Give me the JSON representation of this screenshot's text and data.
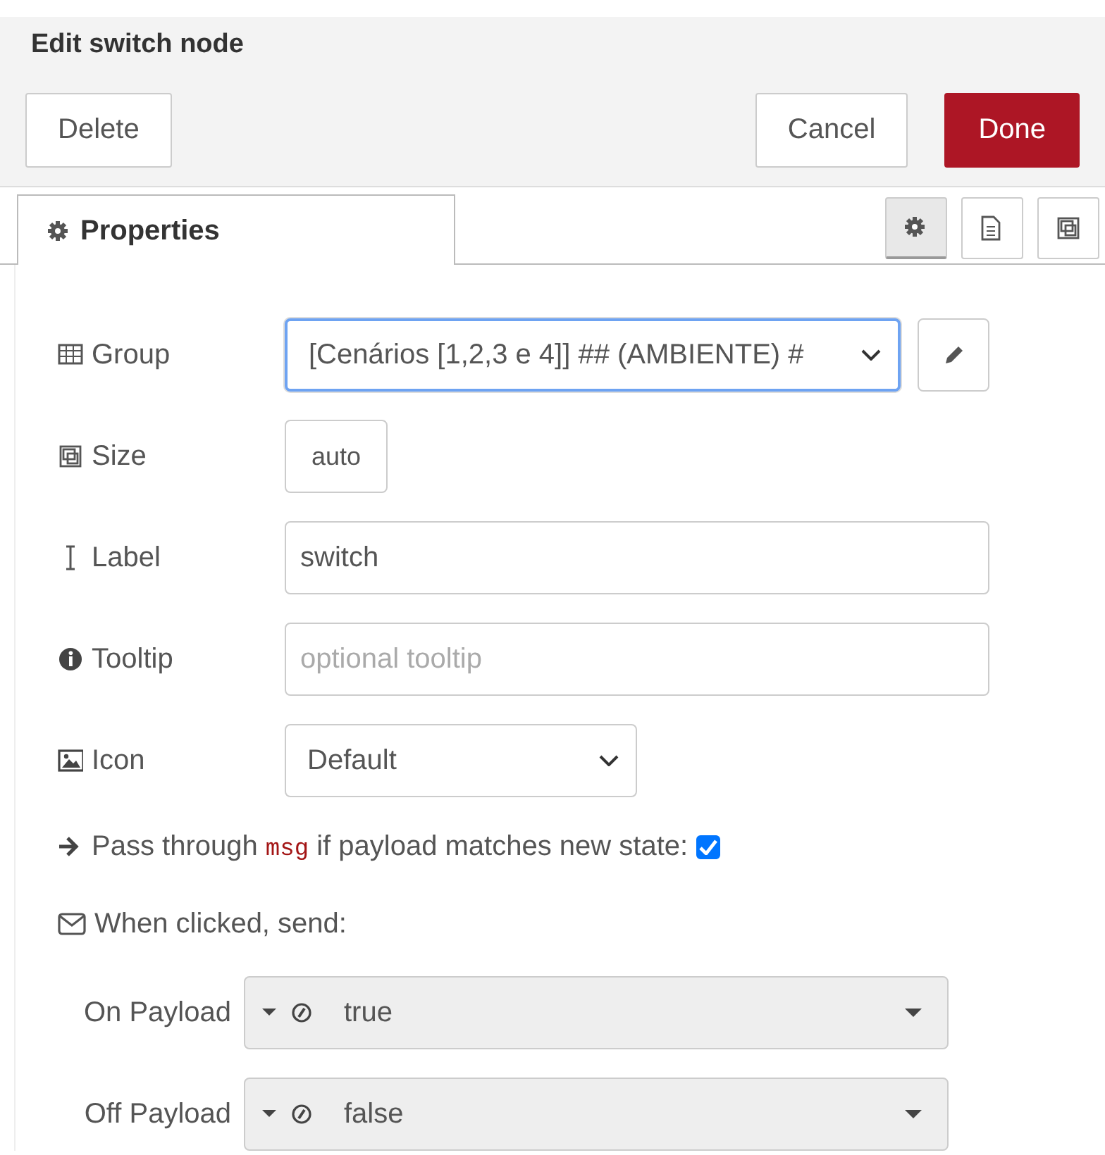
{
  "title": "Edit switch node",
  "buttons": [
    {
      "label": "Delete",
      "kind": "plain"
    },
    {
      "label": "Cancel",
      "kind": "plain"
    },
    {
      "label": "Done",
      "kind": "primary"
    }
  ],
  "tabs": [
    {
      "label": "Properties",
      "selected": true
    }
  ],
  "tab_buttons": [
    {
      "selected": true
    },
    {
      "selected": false
    },
    {
      "selected": false
    }
  ],
  "fields": [
    {
      "kind": "select",
      "label": "Group",
      "value": "[Cenários [1,2,3 e 4]] ## (AMBIENTE) #",
      "focused": true
    },
    {
      "kind": "size",
      "label": "Size",
      "value": "auto"
    },
    {
      "kind": "text",
      "label": "Label",
      "value": "switch"
    },
    {
      "kind": "text",
      "label": "Tooltip",
      "placeholder": "optional tooltip"
    },
    {
      "kind": "select",
      "label": "Icon",
      "value": "Default"
    }
  ],
  "pass_through": {
    "before": "Pass through",
    "code": "msg",
    "after": "if payload matches new state:",
    "checked": true
  },
  "send": {
    "heading": "When clicked, send:",
    "payloads": [
      {
        "label": "On Payload",
        "value": "true"
      },
      {
        "label": "Off Payload",
        "value": "false"
      }
    ]
  }
}
